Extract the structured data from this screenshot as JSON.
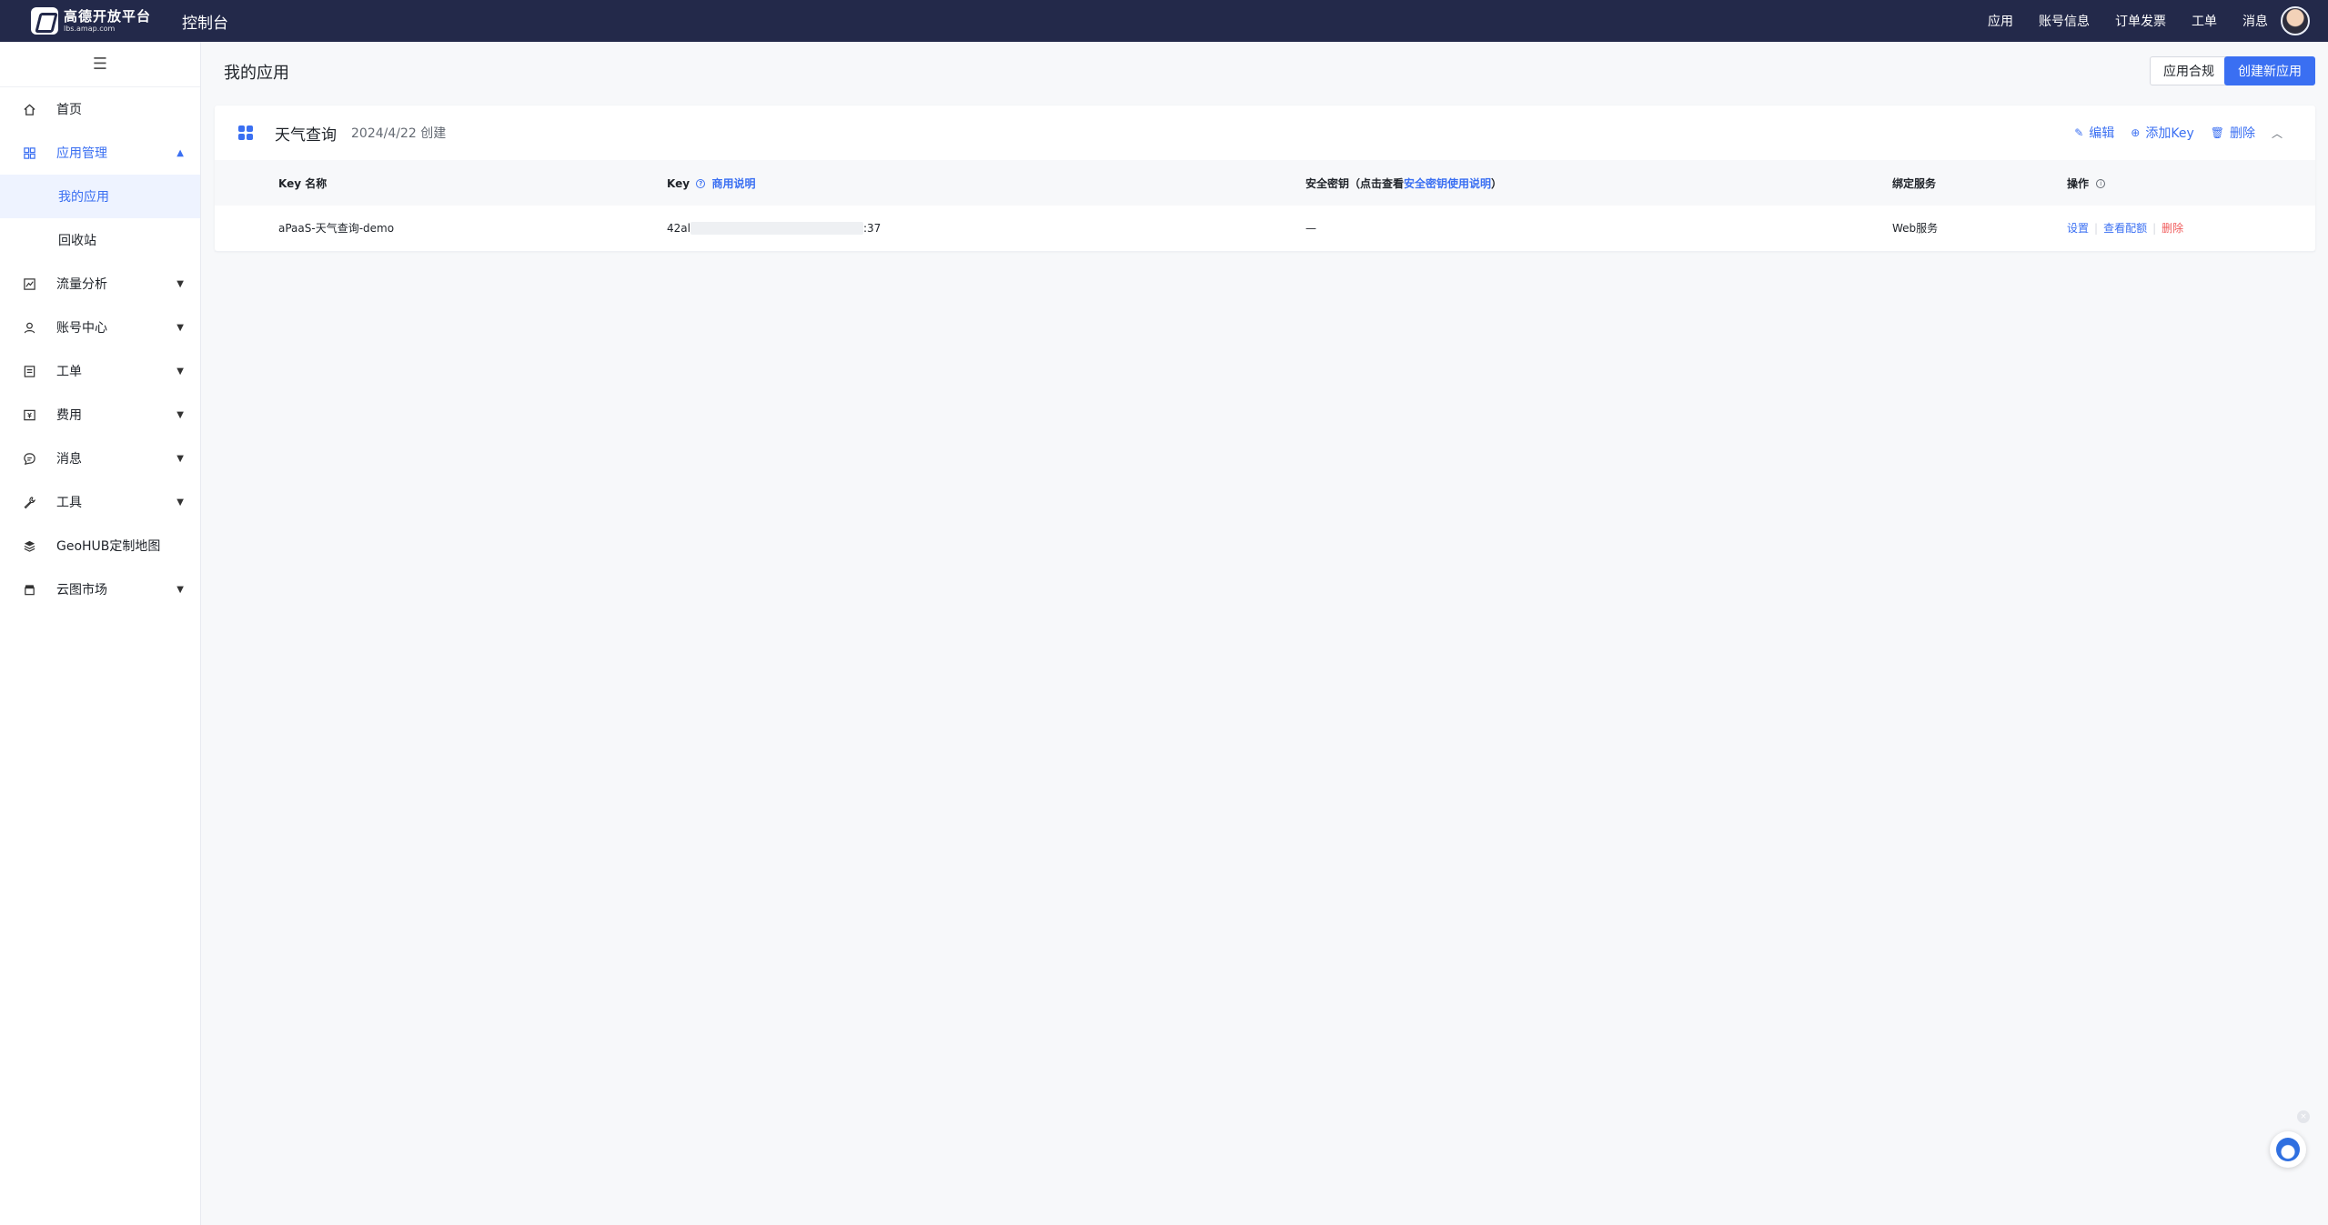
{
  "topbar": {
    "logo_cn": "高德开放平台",
    "logo_en": "lbs.amap.com",
    "console_title": "控制台",
    "nav": [
      "应用",
      "账号信息",
      "订单发票",
      "工单",
      "消息"
    ]
  },
  "sidebar": {
    "collapse_icon": "menu-icon",
    "items": [
      {
        "label": "首页",
        "icon": "home-icon"
      },
      {
        "label": "应用管理",
        "icon": "grid-icon",
        "expanded": true
      },
      {
        "label": "我的应用",
        "sub": true,
        "active": true
      },
      {
        "label": "回收站",
        "sub": true
      },
      {
        "label": "流量分析",
        "icon": "chart-icon"
      },
      {
        "label": "账号中心",
        "icon": "user-icon"
      },
      {
        "label": "工单",
        "icon": "ticket-icon"
      },
      {
        "label": "费用",
        "icon": "billing-icon"
      },
      {
        "label": "消息",
        "icon": "message-icon"
      },
      {
        "label": "工具",
        "icon": "wrench-icon"
      },
      {
        "label": "GeoHUB定制地图",
        "icon": "layers-icon"
      },
      {
        "label": "云图市场",
        "icon": "store-icon"
      }
    ]
  },
  "main": {
    "page_title": "我的应用",
    "compliance_btn": "应用合规",
    "create_btn": "创建新应用",
    "app": {
      "name": "天气查询",
      "created": "2024/4/22 创建",
      "actions": {
        "edit": "编辑",
        "add_key": "添加Key",
        "delete": "删除"
      },
      "columns": {
        "key_name": "Key 名称",
        "key": "Key",
        "key_help": "商用说明",
        "secret_prefix": "安全密钥（点击查看",
        "secret_link": "安全密钥使用说明",
        "secret_suffix": "）",
        "service": "绑定服务",
        "ops": "操作"
      },
      "rows": [
        {
          "key_name": "aPaaS-天气查询-demo",
          "key_start": "42al",
          "key_end": ":37",
          "secret": "—",
          "service": "Web服务",
          "ops": {
            "settings": "设置",
            "quota": "查看配额",
            "delete": "删除"
          }
        }
      ]
    }
  },
  "colors": {
    "topbar_bg": "#23294a",
    "accent": "#3a6ff2",
    "danger": "#f05b5b",
    "page_bg": "#f7f8fa"
  }
}
